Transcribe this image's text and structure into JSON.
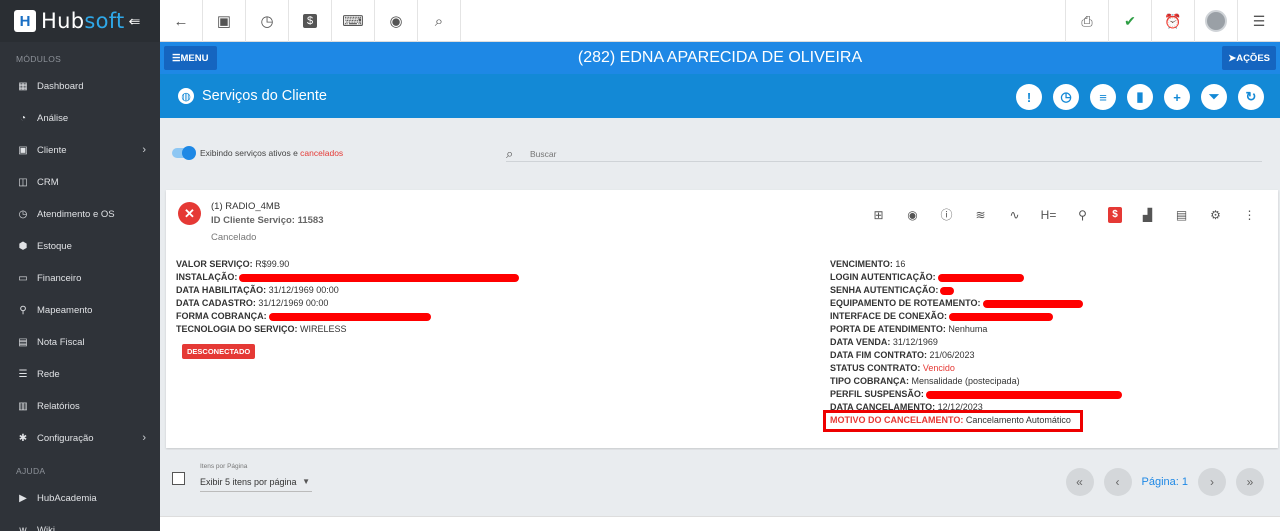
{
  "brand": {
    "name_a": "Hub",
    "name_b": "soft",
    "collapse": "⇚"
  },
  "sidebar": {
    "sections": [
      {
        "title": "MÓDULOS",
        "items": [
          {
            "label": "Dashboard",
            "icon": "dashboard-icon",
            "glyph": "▦",
            "chevron": ""
          },
          {
            "label": "Análise",
            "icon": "analysis-icon",
            "glyph": "◔",
            "chevron": ""
          },
          {
            "label": "Cliente",
            "icon": "client-icon",
            "glyph": "▣",
            "chevron": "›"
          },
          {
            "label": "CRM",
            "icon": "crm-icon",
            "glyph": "◫",
            "chevron": ""
          },
          {
            "label": "Atendimento e OS",
            "icon": "service-order-icon",
            "glyph": "◷",
            "chevron": ""
          },
          {
            "label": "Estoque",
            "icon": "stock-icon",
            "glyph": "⬢",
            "chevron": ""
          },
          {
            "label": "Financeiro",
            "icon": "finance-icon",
            "glyph": "▭",
            "chevron": ""
          },
          {
            "label": "Mapeamento",
            "icon": "map-pin-icon",
            "glyph": "⚲",
            "chevron": ""
          },
          {
            "label": "Nota Fiscal",
            "icon": "invoice-icon",
            "glyph": "▤",
            "chevron": ""
          },
          {
            "label": "Rede",
            "icon": "network-icon",
            "glyph": "☰",
            "chevron": ""
          },
          {
            "label": "Relatórios",
            "icon": "reports-icon",
            "glyph": "▥",
            "chevron": ""
          },
          {
            "label": "Configuração",
            "icon": "gear-icon",
            "glyph": "✱",
            "chevron": "›"
          }
        ]
      },
      {
        "title": "AJUDA",
        "items": [
          {
            "label": "HubAcademia",
            "icon": "academy-icon",
            "glyph": "▶",
            "chevron": ""
          },
          {
            "label": "Wiki",
            "icon": "wiki-icon",
            "glyph": "w",
            "chevron": ""
          }
        ]
      }
    ]
  },
  "topbar": {
    "back": "←",
    "contact": "▣",
    "calendar": "◷",
    "money": "$",
    "terminal": "⌨",
    "view": "◉",
    "search": "⌕",
    "pdf": "⎙",
    "check": "✔",
    "alarm": "⏰",
    "menu": "☰",
    "colors": {
      "check": "#2e9e44",
      "alarm": "#e53935",
      "pdf": "#555555"
    }
  },
  "client": {
    "title": "(282) EDNA APARECIDA DE OLIVEIRA",
    "menu_label": "☰MENU",
    "actions_label": "➤AÇÕES"
  },
  "services": {
    "title": "Serviços do Cliente",
    "actions": [
      "!",
      "◷",
      "≡",
      "▮",
      "+",
      "⏷",
      "↻"
    ]
  },
  "filter": {
    "toggle_label": "Exibindo serviços ativos e ",
    "toggle_label_red": "cancelados",
    "search_placeholder": "Buscar"
  },
  "service": {
    "name": "(1) RADIO_4MB",
    "id_line": "ID Cliente Serviço: 11583",
    "status": "Cancelado",
    "badge": "DESCONECTADO",
    "icons": [
      "⊞",
      "◉",
      "ⓘ",
      "≋",
      "∿",
      "H=",
      "⚲",
      "$",
      "▟",
      "▤",
      "⚙",
      "⋮"
    ],
    "left": [
      {
        "k": "VALOR SERVIÇO:",
        "v": " R$99.90",
        "redact": 0
      },
      {
        "k": "INSTALAÇÃO:",
        "v": "",
        "redact": 280
      },
      {
        "k": "DATA HABILITAÇÃO:",
        "v": " 31/12/1969 00:00",
        "redact": 0
      },
      {
        "k": "DATA CADASTRO:",
        "v": " 31/12/1969 00:00",
        "redact": 0
      },
      {
        "k": "FORMA COBRANÇA:",
        "v": "",
        "redact": 162
      },
      {
        "k": "TECNOLOGIA DO SERVIÇO:",
        "v": " WIRELESS",
        "redact": 0
      }
    ],
    "right": [
      {
        "k": "VENCIMENTO:",
        "v": " 16",
        "redact": 0,
        "red": false
      },
      {
        "k": "LOGIN AUTENTICAÇÃO:",
        "v": "",
        "redact": 86,
        "red": false
      },
      {
        "k": "SENHA AUTENTICAÇÃO:",
        "v": "",
        "redact": 14,
        "red": false
      },
      {
        "k": "EQUIPAMENTO DE ROTEAMENTO:",
        "v": "",
        "redact": 100,
        "red": false
      },
      {
        "k": "INTERFACE DE CONEXÃO:",
        "v": "",
        "redact": 104,
        "red": false
      },
      {
        "k": "PORTA DE ATENDIMENTO:",
        "v": " Nenhuma",
        "redact": 0,
        "red": false
      },
      {
        "k": "DATA VENDA:",
        "v": " 31/12/1969",
        "redact": 0,
        "red": false
      },
      {
        "k": "DATA FIM CONTRATO:",
        "v": " 21/06/2023",
        "redact": 0,
        "red": false
      },
      {
        "k": "STATUS CONTRATO:",
        "v": " Vencido",
        "redact": 0,
        "red": true
      },
      {
        "k": "TIPO COBRANÇA:",
        "v": " Mensalidade (postecipada)",
        "redact": 0,
        "red": false
      },
      {
        "k": "PERFIL SUSPENSÃO:",
        "v": "",
        "redact": 196,
        "red": false
      },
      {
        "k": "DATA CANCELAMENTO:",
        "v": " 12/12/2023",
        "redact": 0,
        "red": false
      },
      {
        "k": "MOTIVO DO CANCELAMENTO:",
        "v": " Cancelamento Automático",
        "redact": 0,
        "red": false,
        "keyred": true
      }
    ]
  },
  "footer": {
    "per_page_label": "Itens por Página",
    "per_page_value": "Exibir 5 itens por página",
    "page_label": "Página: 1",
    "first": "«",
    "prev": "‹",
    "next": "›",
    "last": "»"
  }
}
